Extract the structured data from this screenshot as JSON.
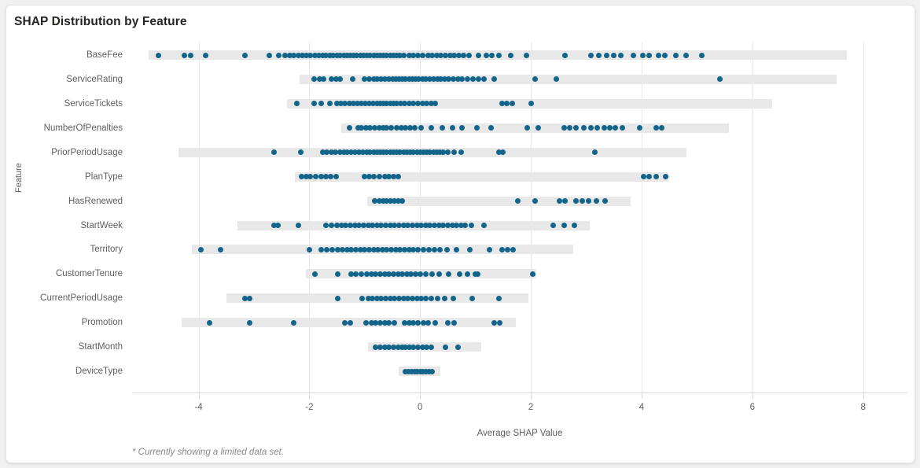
{
  "card": {
    "title": "SHAP Distribution by Feature",
    "footnote": "* Currently showing a limited data set."
  },
  "axes": {
    "y_title": "Feature",
    "x_title": "Average SHAP Value",
    "x_ticks": [
      "-4",
      "-2",
      "0",
      "2",
      "4",
      "6",
      "8"
    ]
  },
  "colors": {
    "dot": "#12648a",
    "range_bar": "#e8e8e8",
    "gridline": "#e8e8e8",
    "title_text": "#252423",
    "axis_text": "#605e5c",
    "footnote_text": "#8a8886",
    "card_background": "#ffffff"
  },
  "chart_data": {
    "type": "scatter",
    "title": "SHAP Distribution by Feature",
    "subtitle": "* Currently showing a limited data set.",
    "xlabel": "Average SHAP Value",
    "ylabel": "Feature",
    "xlim": [
      -5.2,
      8.8
    ],
    "x_tick_values": [
      -4,
      -2,
      0,
      2,
      4,
      6,
      8
    ],
    "grid": "vertical",
    "legend": "none",
    "orientation": "horizontal",
    "categories": [
      "BaseFee",
      "ServiceRating",
      "ServiceTickets",
      "NumberOfPenalties",
      "PriorPeriodUsage",
      "PlanType",
      "HasRenewed",
      "StartWeek",
      "Territory",
      "CustomerTenure",
      "CurrentPeriodUsage",
      "Promotion",
      "StartMonth",
      "DeviceType"
    ],
    "series": [
      {
        "name": "BaseFee",
        "range": [
          -4.9,
          7.7
        ],
        "points": [
          -4.72,
          -4.26,
          -4.14,
          -3.87,
          -3.16,
          -2.72,
          -2.55,
          -2.44,
          -2.36,
          -2.28,
          -2.2,
          -2.12,
          -2.05,
          -1.98,
          -1.9,
          -1.83,
          -1.76,
          -1.7,
          -1.63,
          -1.57,
          -1.5,
          -1.44,
          -1.38,
          -1.32,
          -1.26,
          -1.2,
          -1.14,
          -1.08,
          -1.02,
          -0.96,
          -0.9,
          -0.84,
          -0.78,
          -0.72,
          -0.66,
          -0.6,
          -0.54,
          -0.48,
          -0.42,
          -0.36,
          -0.3,
          -0.2,
          -0.12,
          -0.04,
          0.05,
          0.14,
          0.22,
          0.3,
          0.38,
          0.46,
          0.54,
          0.62,
          0.7,
          0.78,
          0.88,
          1.06,
          1.2,
          1.3,
          1.43,
          1.63,
          1.92,
          2.62,
          3.08,
          3.22,
          3.37,
          3.5,
          3.62,
          3.85,
          4.02,
          4.14,
          4.3,
          4.42,
          4.62,
          4.8,
          5.08
        ],
        "count": 75
      },
      {
        "name": "ServiceRating",
        "range": [
          -2.18,
          7.52
        ],
        "points": [
          -1.91,
          -1.82,
          -1.74,
          -1.6,
          -1.52,
          -1.44,
          -1.22,
          -1.0,
          -0.92,
          -0.84,
          -0.78,
          -0.7,
          -0.63,
          -0.56,
          -0.5,
          -0.44,
          -0.38,
          -0.32,
          -0.26,
          -0.2,
          -0.14,
          -0.08,
          -0.02,
          0.04,
          0.1,
          0.17,
          0.24,
          0.31,
          0.38,
          0.45,
          0.52,
          0.6,
          0.68,
          0.76,
          0.86,
          0.96,
          1.06,
          1.16,
          1.34,
          2.08,
          2.46,
          5.42
        ],
        "count": 42
      },
      {
        "name": "ServiceTickets",
        "range": [
          -2.4,
          6.36
        ],
        "points": [
          -2.23,
          -1.92,
          -1.78,
          -1.63,
          -1.5,
          -1.43,
          -1.36,
          -1.28,
          -1.2,
          -1.13,
          -1.06,
          -0.99,
          -0.92,
          -0.85,
          -0.78,
          -0.72,
          -0.66,
          -0.6,
          -0.54,
          -0.48,
          -0.42,
          -0.35,
          -0.28,
          -0.2,
          -0.12,
          -0.04,
          0.04,
          0.12,
          0.2,
          0.28,
          1.48,
          1.56,
          1.66,
          2.0
        ],
        "count": 34
      },
      {
        "name": "NumberOfPenalties",
        "range": [
          -1.43,
          5.58
        ],
        "points": [
          -1.27,
          -1.12,
          -1.06,
          -0.98,
          -0.9,
          -0.82,
          -0.74,
          -0.67,
          -0.6,
          -0.52,
          -0.42,
          -0.34,
          -0.26,
          -0.18,
          -0.1,
          0.02,
          0.2,
          0.4,
          0.58,
          0.76,
          1.02,
          1.28,
          1.94,
          2.14,
          2.6,
          2.7,
          2.82,
          2.96,
          3.08,
          3.2,
          3.32,
          3.42,
          3.52,
          3.66,
          3.96,
          4.26,
          4.36
        ],
        "count": 37
      },
      {
        "name": "PriorPeriodUsage",
        "range": [
          -4.36,
          4.81
        ],
        "points": [
          -2.64,
          -2.16,
          -1.76,
          -1.68,
          -1.6,
          -1.53,
          -1.45,
          -1.38,
          -1.31,
          -1.24,
          -1.17,
          -1.1,
          -1.03,
          -0.96,
          -0.9,
          -0.84,
          -0.78,
          -0.72,
          -0.66,
          -0.6,
          -0.54,
          -0.48,
          -0.42,
          -0.36,
          -0.3,
          -0.24,
          -0.18,
          -0.12,
          -0.06,
          0.0,
          0.06,
          0.12,
          0.18,
          0.24,
          0.3,
          0.36,
          0.42,
          0.5,
          0.62,
          0.74,
          1.42,
          1.5,
          3.16
        ],
        "count": 43
      },
      {
        "name": "PlanType",
        "range": [
          -2.26,
          4.48
        ],
        "points": [
          -2.14,
          -2.06,
          -1.98,
          -1.88,
          -1.78,
          -1.7,
          -1.62,
          -1.52,
          -1.0,
          -0.92,
          -0.84,
          -0.74,
          -0.64,
          -0.56,
          -0.48,
          -0.4,
          4.04,
          4.14,
          4.26,
          4.44
        ],
        "count": 20
      },
      {
        "name": "HasRenewed",
        "range": [
          -0.95,
          3.8
        ],
        "points": [
          -0.82,
          -0.74,
          -0.67,
          -0.6,
          -0.53,
          -0.46,
          -0.39,
          -0.32,
          1.76,
          2.08,
          2.52,
          2.62,
          2.82,
          2.93,
          3.04,
          3.18,
          3.34
        ],
        "count": 17
      },
      {
        "name": "StartWeek",
        "range": [
          -3.3,
          3.07
        ],
        "points": [
          -2.64,
          -2.56,
          -2.2,
          -1.7,
          -1.6,
          -1.5,
          -1.42,
          -1.34,
          -1.26,
          -1.18,
          -1.1,
          -1.02,
          -0.94,
          -0.86,
          -0.78,
          -0.7,
          -0.62,
          -0.54,
          -0.46,
          -0.38,
          -0.3,
          -0.22,
          -0.14,
          -0.06,
          0.02,
          0.1,
          0.18,
          0.26,
          0.34,
          0.42,
          0.5,
          0.58,
          0.66,
          0.74,
          0.82,
          0.92,
          1.16,
          2.4,
          2.6,
          2.78
        ],
        "count": 40
      },
      {
        "name": "Territory",
        "range": [
          -4.12,
          2.76
        ],
        "points": [
          -3.96,
          -3.6,
          -2.0,
          -1.78,
          -1.68,
          -1.58,
          -1.48,
          -1.4,
          -1.32,
          -1.24,
          -1.16,
          -1.08,
          -1.0,
          -0.92,
          -0.84,
          -0.76,
          -0.68,
          -0.6,
          -0.52,
          -0.44,
          -0.36,
          -0.28,
          -0.2,
          -0.12,
          -0.04,
          0.06,
          0.16,
          0.26,
          0.36,
          0.48,
          0.66,
          0.9,
          1.26,
          1.48,
          1.58,
          1.68
        ],
        "count": 36
      },
      {
        "name": "CustomerTenure",
        "range": [
          -2.06,
          2.1
        ],
        "points": [
          -1.9,
          -1.48,
          -1.24,
          -1.16,
          -1.06,
          -0.96,
          -0.88,
          -0.8,
          -0.72,
          -0.64,
          -0.56,
          -0.48,
          -0.4,
          -0.32,
          -0.24,
          -0.16,
          -0.08,
          0.0,
          0.1,
          0.22,
          0.34,
          0.52,
          0.72,
          0.86,
          1.0,
          1.04,
          2.04
        ],
        "count": 27
      },
      {
        "name": "CurrentPeriodUsage",
        "range": [
          -3.5,
          1.96
        ],
        "points": [
          -3.16,
          -3.08,
          -1.48,
          -1.04,
          -0.94,
          -0.86,
          -0.78,
          -0.7,
          -0.62,
          -0.54,
          -0.46,
          -0.38,
          -0.3,
          -0.22,
          -0.14,
          -0.06,
          0.02,
          0.1,
          0.2,
          0.32,
          0.44,
          0.6,
          0.94,
          1.42
        ],
        "count": 24
      },
      {
        "name": "Promotion",
        "range": [
          -4.3,
          1.73
        ],
        "points": [
          -3.8,
          -3.08,
          -2.28,
          -1.36,
          -1.26,
          -0.98,
          -0.88,
          -0.8,
          -0.72,
          -0.64,
          -0.56,
          -0.46,
          -0.28,
          -0.2,
          -0.12,
          -0.04,
          0.06,
          0.14,
          0.28,
          0.5,
          0.62,
          1.34,
          1.44
        ],
        "count": 23
      },
      {
        "name": "StartMonth",
        "range": [
          -0.94,
          1.1
        ],
        "points": [
          -0.8,
          -0.72,
          -0.64,
          -0.56,
          -0.48,
          -0.4,
          -0.32,
          -0.26,
          -0.2,
          -0.12,
          -0.04,
          0.04,
          0.12,
          0.2,
          0.46,
          0.68
        ],
        "count": 16
      },
      {
        "name": "DeviceType",
        "range": [
          -0.39,
          0.36
        ],
        "points": [
          -0.27,
          -0.21,
          -0.15,
          -0.1,
          -0.05,
          0.0,
          0.05,
          0.1,
          0.16,
          0.22
        ],
        "count": 10
      }
    ]
  }
}
